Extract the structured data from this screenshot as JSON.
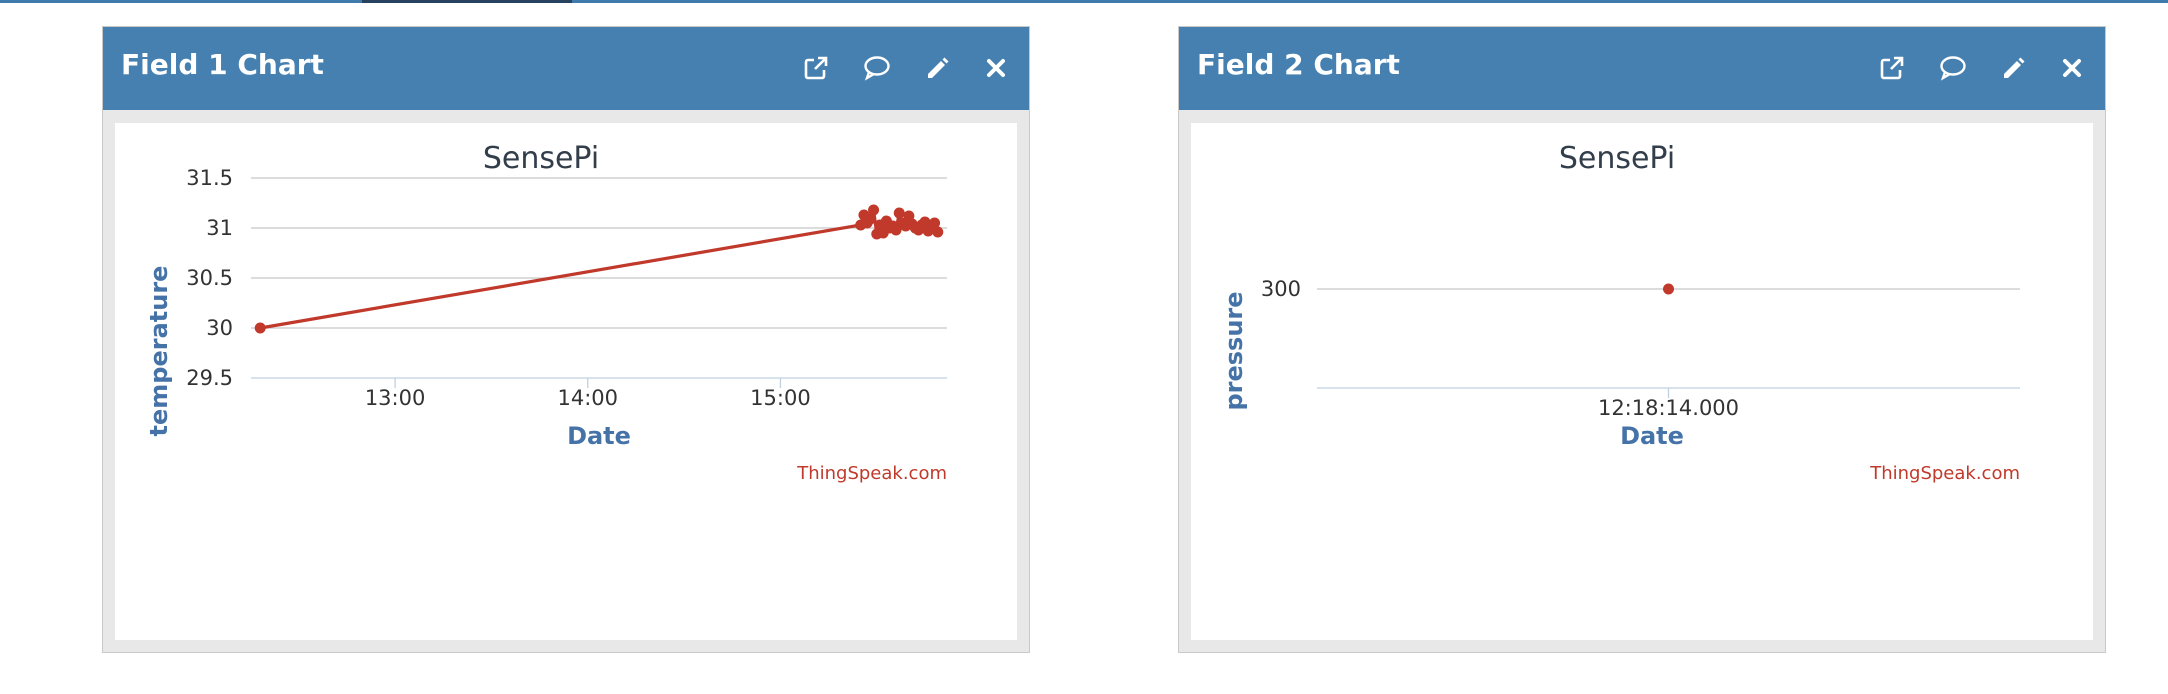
{
  "panels": [
    {
      "title": "Field 1 Chart",
      "tools": [
        "external-link-icon",
        "comment-icon",
        "pencil-icon",
        "close-icon"
      ]
    },
    {
      "title": "Field 2 Chart",
      "tools": [
        "external-link-icon",
        "comment-icon",
        "pencil-icon",
        "close-icon"
      ]
    }
  ],
  "colors": {
    "header": "#4680b0",
    "series": "#c0392b",
    "axis_title": "#4572a7",
    "chart_title": "#333e4b",
    "credits": "#c0392b"
  },
  "chart_data": [
    {
      "type": "line",
      "title": "SensePi",
      "xlabel": "Date",
      "ylabel": "temperature",
      "credits": "ThingSpeak.com",
      "x_ticks": [
        "13:00",
        "14:00",
        "15:00"
      ],
      "y_ticks": [
        "29.5",
        "30",
        "30.5",
        "31",
        "31.5"
      ],
      "ylim": [
        29.5,
        31.5
      ],
      "xlim": [
        "12:17",
        "15:50"
      ],
      "grid": true,
      "legend": "none",
      "series": [
        {
          "x": [
            "12:18",
            "15:25",
            "15:26",
            "15:27",
            "15:28",
            "15:29",
            "15:30",
            "15:31",
            "15:32",
            "15:33",
            "15:34",
            "15:35",
            "15:36",
            "15:37",
            "15:38",
            "15:39",
            "15:40",
            "15:41",
            "15:42",
            "15:43",
            "15:44",
            "15:45",
            "15:46",
            "15:47",
            "15:48",
            "15:49"
          ],
          "y": [
            30.0,
            31.03,
            31.13,
            31.05,
            31.09,
            31.18,
            30.94,
            31.03,
            30.95,
            31.07,
            31.0,
            31.02,
            30.98,
            31.15,
            31.05,
            31.02,
            31.12,
            31.04,
            31.0,
            30.98,
            31.03,
            31.06,
            30.97,
            31.01,
            31.05,
            30.96
          ]
        }
      ]
    },
    {
      "type": "scatter",
      "title": "SensePi",
      "xlabel": "Date",
      "ylabel": "pressure",
      "credits": "ThingSpeak.com",
      "x_ticks": [
        "12:18:14.000"
      ],
      "y_ticks": [
        "300"
      ],
      "grid": true,
      "legend": "none",
      "series": [
        {
          "x": [
            "12:18:14.000"
          ],
          "y": [
            300
          ]
        }
      ]
    }
  ]
}
